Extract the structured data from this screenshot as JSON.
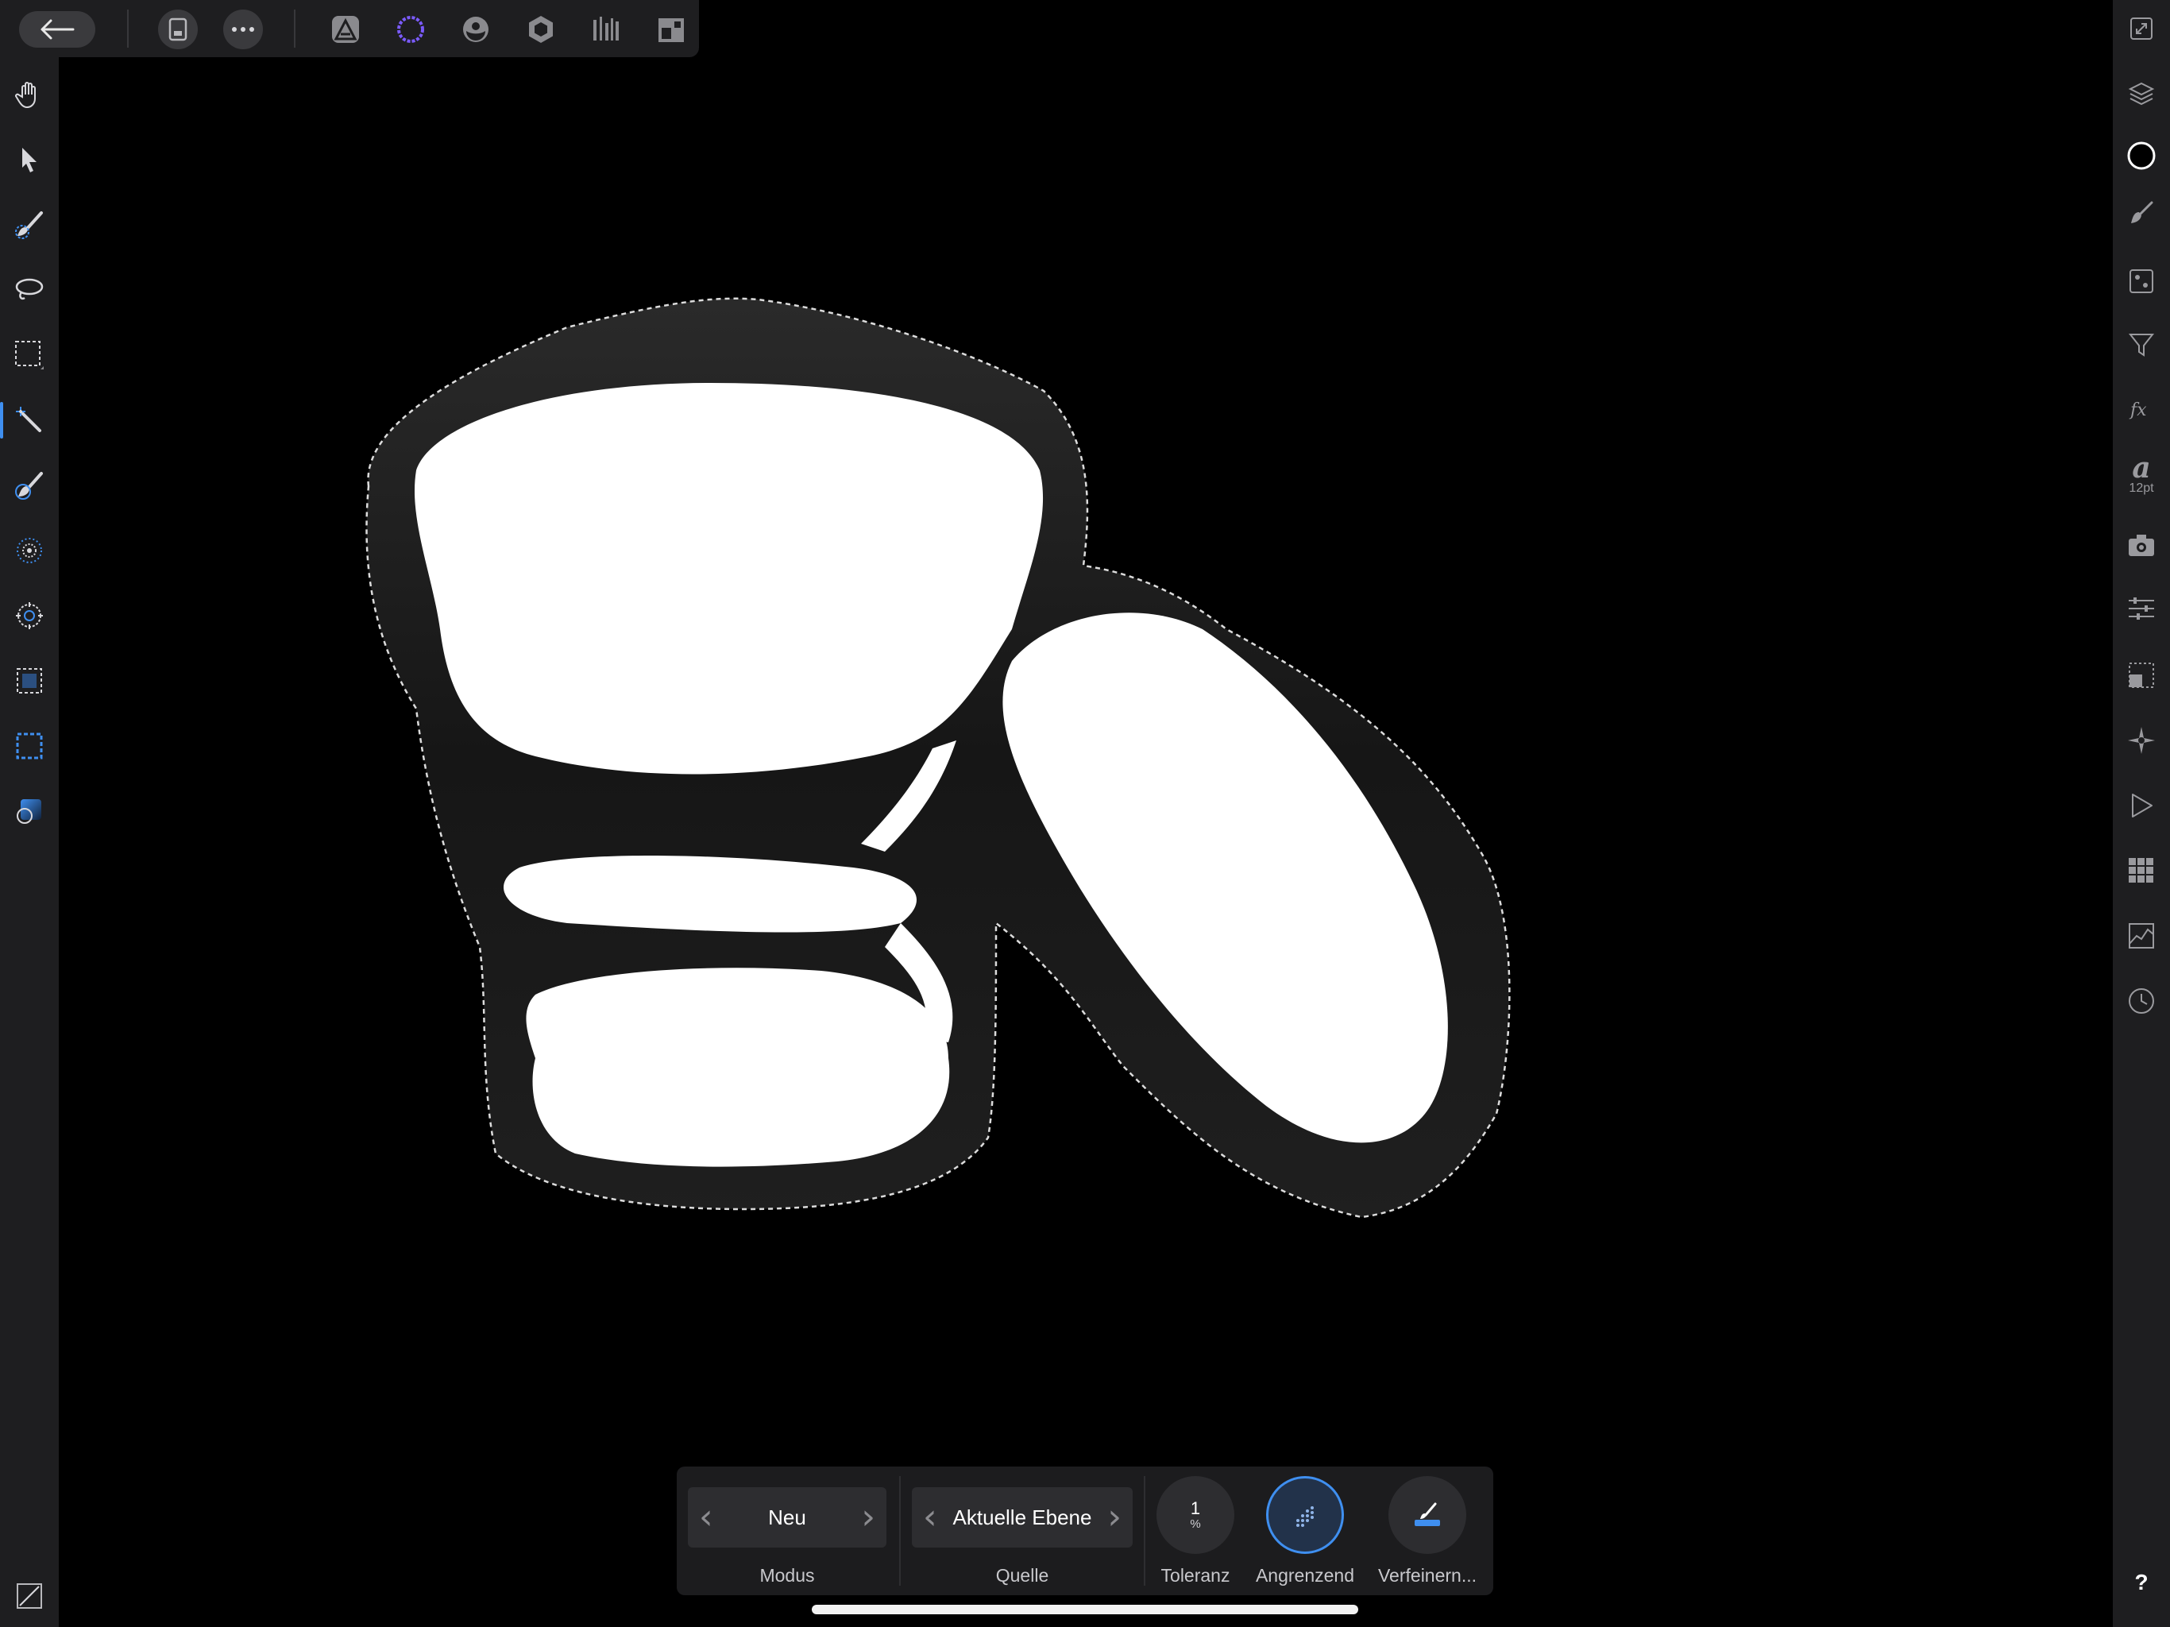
{
  "top_toolbar": {
    "buttons": [
      {
        "name": "back-button",
        "icon": "arrow-left-icon"
      },
      {
        "name": "document-button",
        "icon": "document-icon"
      },
      {
        "name": "more-button",
        "icon": "ellipsis-icon"
      },
      {
        "name": "photo-persona-button",
        "icon": "photo-persona-icon"
      },
      {
        "name": "liquify-persona-button",
        "icon": "liquify-persona-icon"
      },
      {
        "name": "develop-persona-button",
        "icon": "develop-persona-icon"
      },
      {
        "name": "tone-mapping-persona-button",
        "icon": "tone-mapping-persona-icon"
      },
      {
        "name": "export-persona-button",
        "icon": "export-persona-icon"
      },
      {
        "name": "layout-persona-button",
        "icon": "layout-persona-icon"
      }
    ],
    "accent_color": "#7b5bff"
  },
  "left_tools": [
    "hand-tool",
    "move-tool",
    "selection-brush-tool",
    "freehand-selection-tool",
    "rectangular-marquee-tool",
    "flood-select-tool",
    "paint-brush-tool",
    "radial-tool",
    "target-tool",
    "crop-tool",
    "marquee-frame-tool",
    "gradient-tool"
  ],
  "active_tool": "flood-select-tool",
  "right_panel": {
    "font_size_label": "12pt",
    "help_label": "?"
  },
  "context_toolbar": {
    "mode": {
      "value": "Neu",
      "label": "Modus"
    },
    "source": {
      "value": "Aktuelle Ebene",
      "label": "Quelle"
    },
    "tolerance": {
      "value": "1",
      "unit": "%",
      "label": "Toleranz"
    },
    "contiguous": {
      "label": "Angrenzend",
      "selected": true
    },
    "refine": {
      "label": "Verfeinern..."
    }
  },
  "colors": {
    "panel": "#1e1e20",
    "accent_blue": "#3f8ff0",
    "canvas": "#000000",
    "drawing_fill": "#ffffff",
    "drawing_shadow": "#1a1a1a"
  }
}
